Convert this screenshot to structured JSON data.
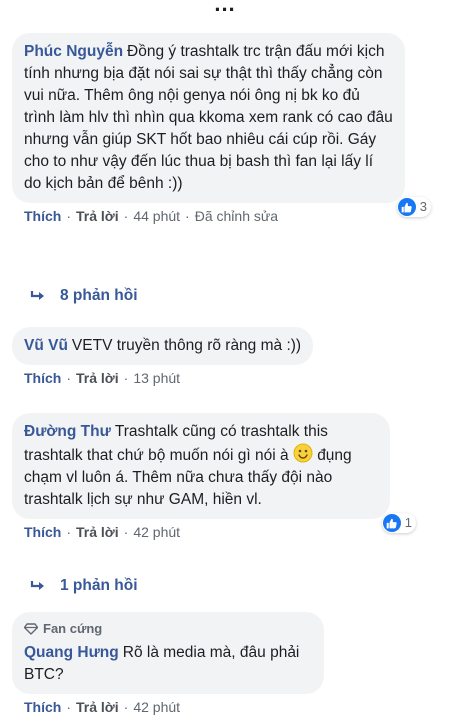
{
  "more_indicator": "...",
  "comments": [
    {
      "author": "Phúc Nguyễn",
      "text": "Đồng ý trashtalk trc trận đấu mới kịch tính nhưng bịa đặt nói sai sự thật thì thấy chẳng còn vui nữa. Thêm ông nội genya nói ông nị bk ko đủ trình làm hlv thì nhìn qua kkoma xem rank có cao đâu nhưng vẫn giúp SKT hốt bao nhiêu cái cúp rồi. Gáy cho to như vậy đến lúc thua bị bash thì fan lại lấy lí do kịch bản để bênh :))",
      "like_label": "Thích",
      "reply_label": "Trả lời",
      "time": "44 phút",
      "edited": "Đã chỉnh sửa",
      "reaction_count": "3",
      "replies_label": "8 phản hồi"
    },
    {
      "author": "Vũ Vũ",
      "text": "VETV truyền thông rõ ràng mà :))",
      "like_label": "Thích",
      "reply_label": "Trả lời",
      "time": "13 phút"
    },
    {
      "author": "Đường Thư",
      "text_before_emoji": "Trashtalk cũng có trashtalk this trashtalk that chứ bộ muốn nói gì nói à",
      "text_after_emoji": "đụng chạm vl luôn á. Thêm nữa chưa thấy đội nào trashtalk lịch sự như GAM, hiền vl.",
      "emoji": "smile-emoji",
      "like_label": "Thích",
      "reply_label": "Trả lời",
      "time": "42 phút",
      "reaction_count": "1",
      "replies_label": "1 phản hồi"
    },
    {
      "badge": "Fan cứng",
      "author": "Quang Hưng",
      "text": "Rõ là media mà, đâu phải BTC?",
      "like_label": "Thích",
      "reply_label": "Trả lời",
      "time": "42 phút"
    }
  ],
  "colors": {
    "author": "#385898",
    "bubble": "#f2f3f5",
    "like_blue": "#1877f2",
    "meta": "#606770"
  },
  "icons": {
    "like": "like-icon",
    "reply_arrow": "reply-arrow-icon",
    "fan_badge": "diamond-icon"
  }
}
